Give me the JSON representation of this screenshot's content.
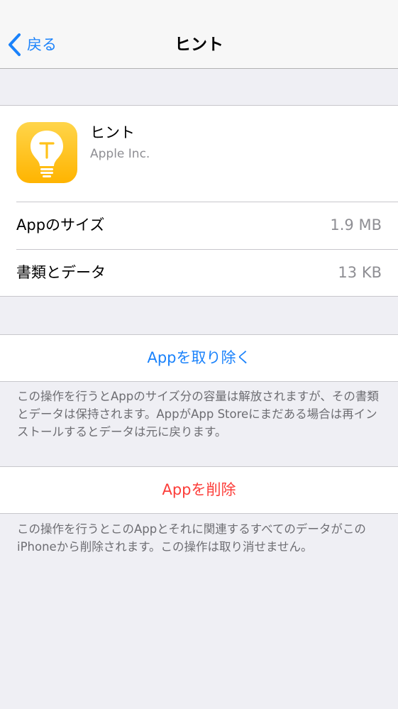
{
  "nav": {
    "back_label": "戻る",
    "title": "ヒント"
  },
  "app": {
    "name": "ヒント",
    "developer": "Apple Inc.",
    "icon": "lightbulb-icon",
    "rows": {
      "size_label": "Appのサイズ",
      "size_value": "1.9 MB",
      "docs_label": "書類とデータ",
      "docs_value": "13 KB"
    }
  },
  "offload": {
    "label": "Appを取り除く",
    "note": "この操作を行うとAppのサイズ分の容量は解放されますが、その書類とデータは保持されます。AppがApp Storeにまだある場合は再インストールするとデータは元に戻ります。"
  },
  "delete": {
    "label": "Appを削除",
    "note": "この操作を行うとこのAppとそれに関連するすべてのデータがこのiPhoneから削除されます。この操作は取り消せません。"
  },
  "colors": {
    "accent": "#1a82fb",
    "destructive": "#fc3d39",
    "background": "#efeff4",
    "secondary_text": "#8e8e93"
  }
}
